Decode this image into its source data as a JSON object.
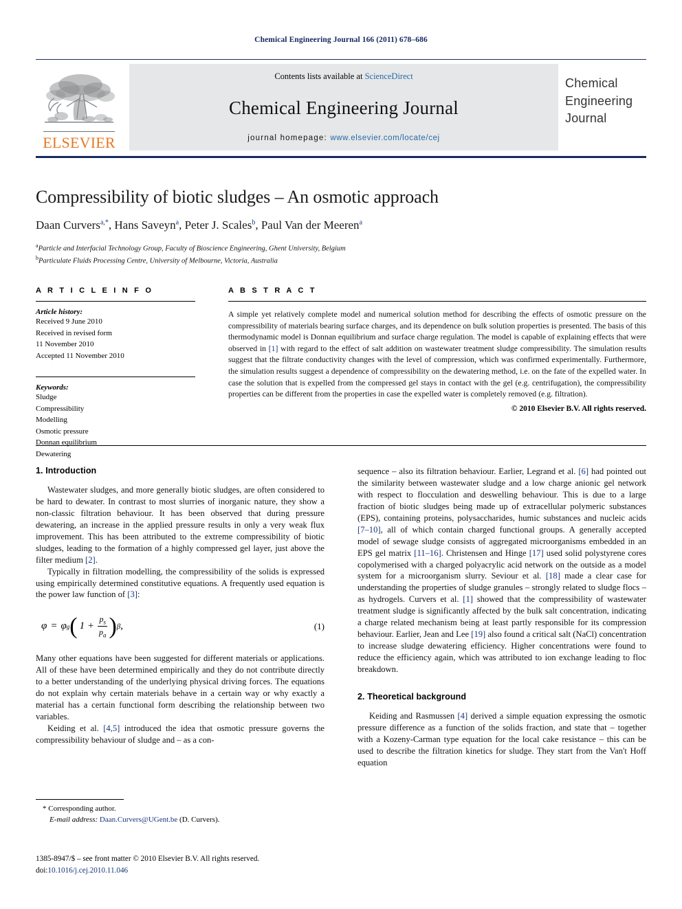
{
  "running_head": "Chemical Engineering Journal 166 (2011) 678–686",
  "masthead": {
    "contents_prefix": "Contents lists available at ",
    "sciencedirect": "ScienceDirect",
    "journal_name": "Chemical Engineering Journal",
    "homepage_prefix": "journal homepage:",
    "homepage_url": "www.elsevier.com/locate/cej",
    "publisher": "ELSEVIER",
    "cover_lines": [
      "Chemical",
      "Engineering",
      "Journal"
    ],
    "accent_orange": "#e87722",
    "rule_navy": "#1a2a5e",
    "panel_gray": "#e6e7e8",
    "link_blue": "#2469a8"
  },
  "title": "Compressibility of biotic sludges – An osmotic approach",
  "authors": [
    {
      "name": "Daan Curvers",
      "marks": "a,*"
    },
    {
      "name": "Hans Saveyn",
      "marks": "a"
    },
    {
      "name": "Peter J. Scales",
      "marks": "b"
    },
    {
      "name": "Paul Van der Meeren",
      "marks": "a"
    }
  ],
  "affiliations": [
    {
      "mark": "a",
      "text": "Particle and Interfacial Technology Group, Faculty of Bioscience Engineering, Ghent University, Belgium"
    },
    {
      "mark": "b",
      "text": "Particulate Fluids Processing Centre, University of Melbourne, Victoria, Australia"
    }
  ],
  "article_info": {
    "heading": "A R T I C L E   I N F O",
    "history_label": "Article history:",
    "history_lines": [
      "Received 9 June 2010",
      "Received in revised form",
      "11 November 2010",
      "Accepted 11 November 2010"
    ],
    "keywords_label": "Keywords:",
    "keywords": [
      "Sludge",
      "Compressibility",
      "Modelling",
      "Osmotic pressure",
      "Donnan equilibrium",
      "Dewatering"
    ]
  },
  "abstract": {
    "heading": "A B S T R A C T",
    "part1": "A simple yet relatively complete model and numerical solution method for describing the effects of osmotic pressure on the compressibility of materials bearing surface charges, and its dependence on bulk solution properties is presented. The basis of this thermodynamic model is Donnan equilibrium and surface charge regulation. The model is capable of explaining effects that were observed in ",
    "ref1": "[1]",
    "part2": " with regard to the effect of salt addition on wastewater treatment sludge compressibility. The simulation results suggest that the filtrate conductivity changes with the level of compression, which was confirmed experimentally. Furthermore, the simulation results suggest a dependence of compressibility on the dewatering method, i.e. on the fate of the expelled water. In case the solution that is expelled from the compressed gel stays in contact with the gel (e.g. centrifugation), the compressibility properties can be different from the properties in case the expelled water is completely removed (e.g. filtration).",
    "copyright": "© 2010 Elsevier B.V. All rights reserved."
  },
  "sections": {
    "intro_heading": "1.  Introduction",
    "theory_heading": "2.  Theoretical background"
  },
  "left_column": {
    "p1_a": "Wastewater sludges, and more generally biotic sludges, are often considered to be hard to dewater. In contrast to most slurries of inorganic nature, they show a non-classic filtration behaviour. It has been observed that during pressure dewatering, an increase in the applied pressure results in only a very weak flux improvement. This has been attributed to the extreme compressibility of biotic sludges, leading to the formation of a highly compressed gel layer, just above the filter medium ",
    "p1_ref": "[2]",
    "p1_b": ".",
    "p2_a": "Typically in filtration modelling, the compressibility of the solids is expressed using empirically determined constitutive equations. A frequently used equation is the power law function of ",
    "p2_ref": "[3]",
    "p2_b": ":",
    "equation": {
      "lhs": "φ",
      "eq": "=",
      "phi_g": "φ",
      "phi_g_sub": "g",
      "one_plus": "1 +",
      "num": "p",
      "num_sub": "s",
      "den": "p",
      "den_sub": "a",
      "exponent": "β",
      "comma": ",",
      "number": "(1)"
    },
    "p3": "Many other equations have been suggested for different materials or applications. All of these have been determined empirically and they do not contribute directly to a better understanding of the underlying physical driving forces. The equations do not explain why certain materials behave in a certain way or why exactly a material has a certain functional form describing the relationship between two variables.",
    "p4_a": "Keiding et al. ",
    "p4_ref": "[4,5]",
    "p4_b": " introduced the idea that osmotic pressure governs the compressibility behaviour of sludge and – as a con-"
  },
  "right_column": {
    "p1_a": "sequence – also its filtration behaviour. Earlier, Legrand et al. ",
    "p1_ref1": "[6]",
    "p1_b": " had pointed out the similarity between wastewater sludge and a low charge anionic gel network with respect to flocculation and deswelling behaviour. This is due to a large fraction of biotic sludges being made up of extracellular polymeric substances (EPS), containing proteins, polysaccharides, humic substances and nucleic acids ",
    "p1_ref2": "[7–10]",
    "p1_c": ", all of which contain charged functional groups. A generally accepted model of sewage sludge consists of aggregated microorganisms embedded in an EPS gel matrix ",
    "p1_ref3": "[11–16]",
    "p1_d": ". Christensen and Hinge ",
    "p1_ref4": "[17]",
    "p1_e": " used solid polystyrene cores copolymerised with a charged polyacrylic acid network on the outside as a model system for a microorganism slurry. Seviour et al. ",
    "p1_ref5": "[18]",
    "p1_f": " made a clear case for understanding the properties of sludge granules – strongly related to sludge flocs – as hydrogels. Curvers et al. ",
    "p1_ref6": "[1]",
    "p1_g": " showed that the compressibility of wastewater treatment sludge is significantly affected by the bulk salt concentration, indicating a charge related mechanism being at least partly responsible for its compression behaviour. Earlier, Jean and Lee ",
    "p1_ref7": "[19]",
    "p1_h": " also found a critical salt (NaCl) concentration to increase sludge dewatering efficiency. Higher concentrations were found to reduce the efficiency again, which was attributed to ion exchange leading to floc breakdown.",
    "p2_a": "Keiding and Rasmussen ",
    "p2_ref": "[4]",
    "p2_b": " derived a simple equation expressing the osmotic pressure difference as a function of the solids fraction, and state that – together with a Kozeny-Carman type equation for the local cake resistance – this can be used to describe the filtration kinetics for sludge. They start from the Van't Hoff equation"
  },
  "footnotes": {
    "corresponding": "*  Corresponding author.",
    "email_label": "E-mail address:",
    "email": "Daan.Curvers@UGent.be",
    "email_suffix": " (D. Curvers).",
    "issn_line": "1385-8947/$ – see front matter © 2010 Elsevier B.V. All rights reserved.",
    "doi_label": "doi:",
    "doi": "10.1016/j.cej.2010.11.046"
  }
}
